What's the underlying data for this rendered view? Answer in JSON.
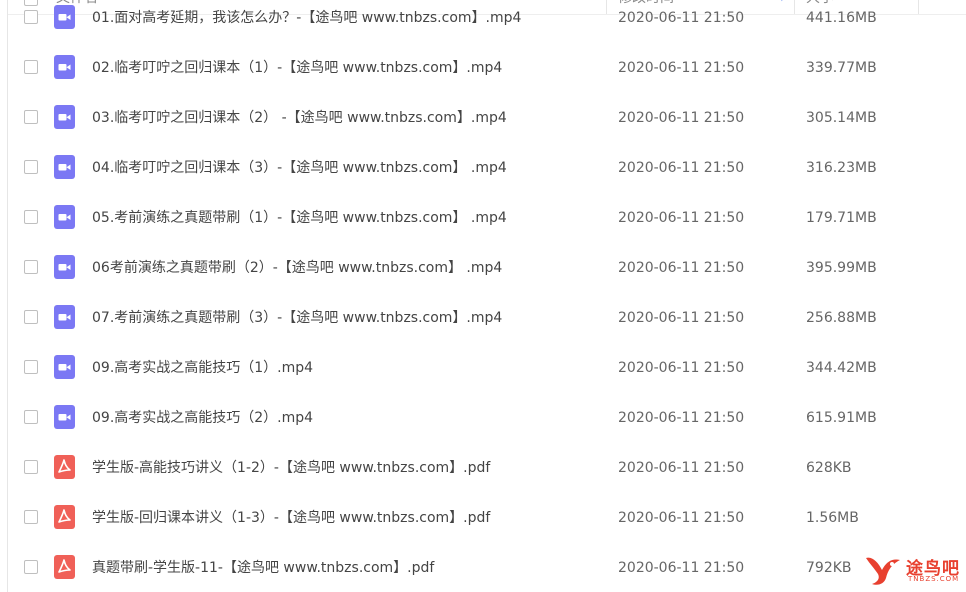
{
  "header": {
    "name_col": "文件名",
    "date_col": "修改时间",
    "size_col": "大小"
  },
  "files": [
    {
      "name": "01.面对高考延期，我该怎么办？-【途鸟吧 www.tnbzs.com】.mp4",
      "date": "2020-06-11 21:50",
      "size": "441.16MB",
      "icon": "video-file-icon"
    },
    {
      "name": "02.临考叮咛之回归课本（1）-【途鸟吧 www.tnbzs.com】.mp4",
      "date": "2020-06-11 21:50",
      "size": "339.77MB",
      "icon": "video-file-icon"
    },
    {
      "name": "03.临考叮咛之回归课本（2） -【途鸟吧 www.tnbzs.com】.mp4",
      "date": "2020-06-11 21:50",
      "size": "305.14MB",
      "icon": "video-file-icon"
    },
    {
      "name": "04.临考叮咛之回归课本（3）-【途鸟吧 www.tnbzs.com】 .mp4",
      "date": "2020-06-11 21:50",
      "size": "316.23MB",
      "icon": "video-file-icon"
    },
    {
      "name": "05.考前演练之真题带刷（1）-【途鸟吧 www.tnbzs.com】 .mp4",
      "date": "2020-06-11 21:50",
      "size": "179.71MB",
      "icon": "video-file-icon"
    },
    {
      "name": "06考前演练之真题带刷（2）-【途鸟吧 www.tnbzs.com】 .mp4",
      "date": "2020-06-11 21:50",
      "size": "395.99MB",
      "icon": "video-file-icon"
    },
    {
      "name": "07.考前演练之真题带刷（3）-【途鸟吧 www.tnbzs.com】.mp4",
      "date": "2020-06-11 21:50",
      "size": "256.88MB",
      "icon": "video-file-icon"
    },
    {
      "name": "09.高考实战之高能技巧（1）.mp4",
      "date": "2020-06-11 21:50",
      "size": "344.42MB",
      "icon": "video-file-icon"
    },
    {
      "name": "09.高考实战之高能技巧（2）.mp4",
      "date": "2020-06-11 21:50",
      "size": "615.91MB",
      "icon": "video-file-icon"
    },
    {
      "name": "学生版-高能技巧讲义（1-2）-【途鸟吧 www.tnbzs.com】.pdf",
      "date": "2020-06-11 21:50",
      "size": "628KB",
      "icon": "pdf-file-icon"
    },
    {
      "name": "学生版-回归课本讲义（1-3）-【途鸟吧 www.tnbzs.com】.pdf",
      "date": "2020-06-11 21:50",
      "size": "1.56MB",
      "icon": "pdf-file-icon"
    },
    {
      "name": "真题带刷-学生版-11-【途鸟吧 www.tnbzs.com】.pdf",
      "date": "2020-06-11 21:50",
      "size": "792KB",
      "icon": "pdf-file-icon"
    }
  ],
  "watermark": {
    "text": "途鸟吧",
    "sub": "TNBZS.COM"
  },
  "colors": {
    "video_icon": "#7b78f4",
    "pdf_icon": "#f06058",
    "watermark": "#e8402f"
  }
}
